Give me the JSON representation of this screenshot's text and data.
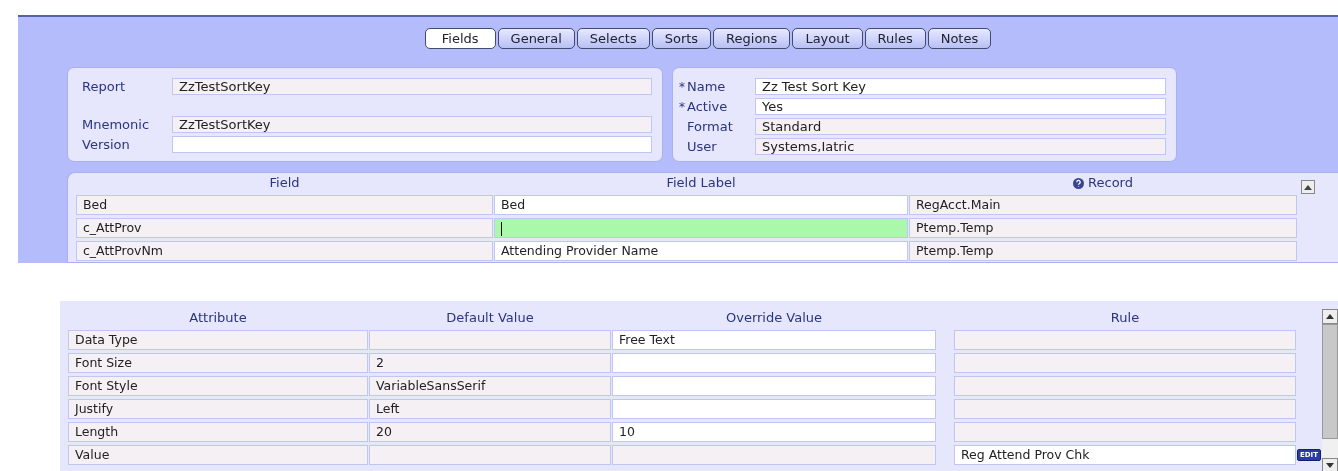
{
  "tabs": [
    {
      "label": "Fields",
      "selected": true
    },
    {
      "label": "General",
      "selected": false
    },
    {
      "label": "Selects",
      "selected": false
    },
    {
      "label": "Sorts",
      "selected": false
    },
    {
      "label": "Regions",
      "selected": false
    },
    {
      "label": "Layout",
      "selected": false
    },
    {
      "label": "Rules",
      "selected": false
    },
    {
      "label": "Notes",
      "selected": false
    }
  ],
  "report_card": {
    "fields": [
      {
        "label": "Report",
        "value": "ZzTestSortKey",
        "editable": false
      },
      {
        "label": "Mnemonic",
        "value": "ZzTestSortKey",
        "editable": false
      },
      {
        "label": "Version",
        "editable": true
      }
    ]
  },
  "name_card": {
    "fields": [
      {
        "required_mark": "*",
        "label": "Name",
        "value": "Zz Test Sort Key",
        "editable": true
      },
      {
        "required_mark": "*",
        "label": "Active",
        "value": "Yes",
        "editable": true
      },
      {
        "label": "Format",
        "value": "Standard",
        "editable": false
      },
      {
        "label": "User",
        "value": "Systems,Iatric",
        "editable": false
      }
    ]
  },
  "fields_table": {
    "columns": [
      {
        "label": "Field",
        "help_icon": false
      },
      {
        "label": "Field Label",
        "help_icon": false
      },
      {
        "label": "Record",
        "help_icon": true
      }
    ],
    "rows": [
      {
        "cells": [
          {
            "value": "Bed",
            "editable": false,
            "focused": false
          },
          {
            "value": "Bed",
            "editable": true,
            "focused": false
          },
          {
            "value": "RegAcct.Main",
            "editable": false,
            "focused": false
          }
        ]
      },
      {
        "cells": [
          {
            "value": "c_AttProv",
            "editable": false,
            "focused": false
          },
          {
            "editable": true,
            "focused": true
          },
          {
            "value": "Ptemp.Temp",
            "editable": false,
            "focused": false
          }
        ]
      },
      {
        "cells": [
          {
            "value": "c_AttProvNm",
            "editable": false,
            "focused": false
          },
          {
            "value": "Attending Provider Name",
            "editable": true,
            "focused": false
          },
          {
            "value": "Ptemp.Temp",
            "editable": false,
            "focused": false
          }
        ]
      }
    ]
  },
  "attributes_table": {
    "columns": [
      {
        "label": "Attribute"
      },
      {
        "label": "Default Value"
      },
      {
        "label": "Override Value"
      },
      {
        "label": "Rule"
      }
    ],
    "rows": [
      {
        "cells": [
          {
            "value": "Data Type",
            "editable": false
          },
          {
            "editable": false
          },
          {
            "value": "Free Text",
            "editable": true
          },
          {
            "editable": false
          }
        ]
      },
      {
        "cells": [
          {
            "value": "Font Size",
            "editable": false
          },
          {
            "value": "2",
            "editable": false
          },
          {
            "editable": true
          },
          {
            "editable": false
          }
        ]
      },
      {
        "cells": [
          {
            "value": "Font Style",
            "editable": false
          },
          {
            "value": "VariableSansSerif",
            "editable": false
          },
          {
            "editable": true
          },
          {
            "editable": false
          }
        ]
      },
      {
        "cells": [
          {
            "value": "Justify",
            "editable": false
          },
          {
            "value": "Left",
            "editable": false
          },
          {
            "editable": true
          },
          {
            "editable": false
          }
        ]
      },
      {
        "cells": [
          {
            "value": "Length",
            "editable": false
          },
          {
            "value": "20",
            "editable": false
          },
          {
            "value": "10",
            "editable": true
          },
          {
            "editable": false
          }
        ]
      },
      {
        "cells": [
          {
            "value": "Value",
            "editable": false
          },
          {
            "editable": false
          },
          {
            "editable": false
          },
          {
            "value": "Reg Attend Prov Chk",
            "editable": true
          }
        ],
        "action": "EDIT"
      }
    ]
  }
}
